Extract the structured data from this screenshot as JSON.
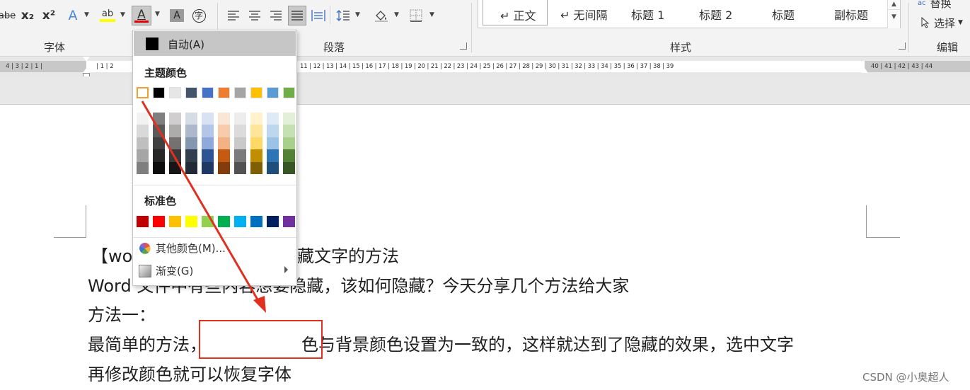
{
  "ribbon": {
    "font_group": {
      "label": "字体",
      "strike_label": "abe",
      "subscript_label": "x₂",
      "superscript_label": "x²",
      "text_effect_label": "A",
      "highlight_label": "ab",
      "font_color_label": "A",
      "char_shading_label": "A",
      "enclose_label": "字"
    },
    "paragraph_group": {
      "label": "段落"
    },
    "styles_group": {
      "label": "样式",
      "items": [
        "↵ 正文",
        "↵ 无间隔",
        "标题 1",
        "标题 2",
        "标题",
        "副标题"
      ]
    },
    "editing_group": {
      "label": "编辑",
      "replace_label": "替换",
      "select_label": "选择"
    }
  },
  "ruler": {
    "left_numbers": "4 | 3 | 2 | 1 |",
    "numbers_a": "| 1 | 2",
    "numbers_b": "11 | 12 | 13 | 14 | 15 | 16 | 17 | 18 | 19 | 20 | 21 | 22 | 23 | 24 | 25 | 26 | 27 | 28 | 29 | 30 | 31 | 32 | 33 | 34 | 35 | 36 | 37 | 38 | 39",
    "numbers_c": "40 | 41 | 42 | 43 | 44"
  },
  "font_color_menu": {
    "auto_label": "自动(A)",
    "theme_title": "主题颜色",
    "standard_title": "标准色",
    "more_colors_label": "其他颜色(M)...",
    "gradient_label": "渐变(G)",
    "theme_top_colors": [
      "#ffffff",
      "#000000",
      "#e7e6e6",
      "#44546a",
      "#4472c4",
      "#ed7d31",
      "#a5a5a5",
      "#ffc000",
      "#5b9bd5",
      "#70ad47"
    ],
    "theme_shades": [
      [
        "#f2f2f2",
        "#d9d9d9",
        "#bfbfbf",
        "#a6a6a6",
        "#7f7f7f"
      ],
      [
        "#7f7f7f",
        "#595959",
        "#404040",
        "#262626",
        "#0d0d0d"
      ],
      [
        "#d0cece",
        "#aeabab",
        "#757171",
        "#3a3838",
        "#171616"
      ],
      [
        "#d6dce4",
        "#adb9ca",
        "#8497b0",
        "#333f4f",
        "#222a35"
      ],
      [
        "#d9e2f3",
        "#b4c6e7",
        "#8eaadb",
        "#2f5496",
        "#1f3864"
      ],
      [
        "#fbe5d5",
        "#f7cbac",
        "#f4b183",
        "#c55a11",
        "#833c0b"
      ],
      [
        "#ededed",
        "#dbdbdb",
        "#c9c9c9",
        "#7b7b7b",
        "#525252"
      ],
      [
        "#fff2cc",
        "#fee599",
        "#ffd965",
        "#bf8f00",
        "#7f6000"
      ],
      [
        "#deebf6",
        "#bdd7ee",
        "#9cc3e5",
        "#2e75b5",
        "#1e4e79"
      ],
      [
        "#e2efd9",
        "#c5e0b3",
        "#a8d08d",
        "#538135",
        "#375623"
      ]
    ],
    "standard_colors": [
      "#c00000",
      "#ff0000",
      "#ffc000",
      "#ffff00",
      "#92d050",
      "#00b050",
      "#00b0f0",
      "#0070c0",
      "#002060",
      "#7030a0"
    ]
  },
  "document": {
    "line1_left": "【wo",
    "line1_right": "藏文字的方法",
    "line2": "Word 文件中有些内容想要隐藏，该如何隐藏？今天分享几个方法给大家",
    "line3": "方法一：",
    "line4_left": "最简单的方法，",
    "line4_right": "色与背景颜色设置为一致的，这样就达到了隐藏的效果，选中文字",
    "line5": "再修改颜色就可以恢复字体"
  },
  "watermark": "CSDN @小奥超人",
  "colors": {
    "annotation_red": "#e23020",
    "font_color_underline": "#e00000",
    "highlight_yellow": "#ffff00"
  }
}
